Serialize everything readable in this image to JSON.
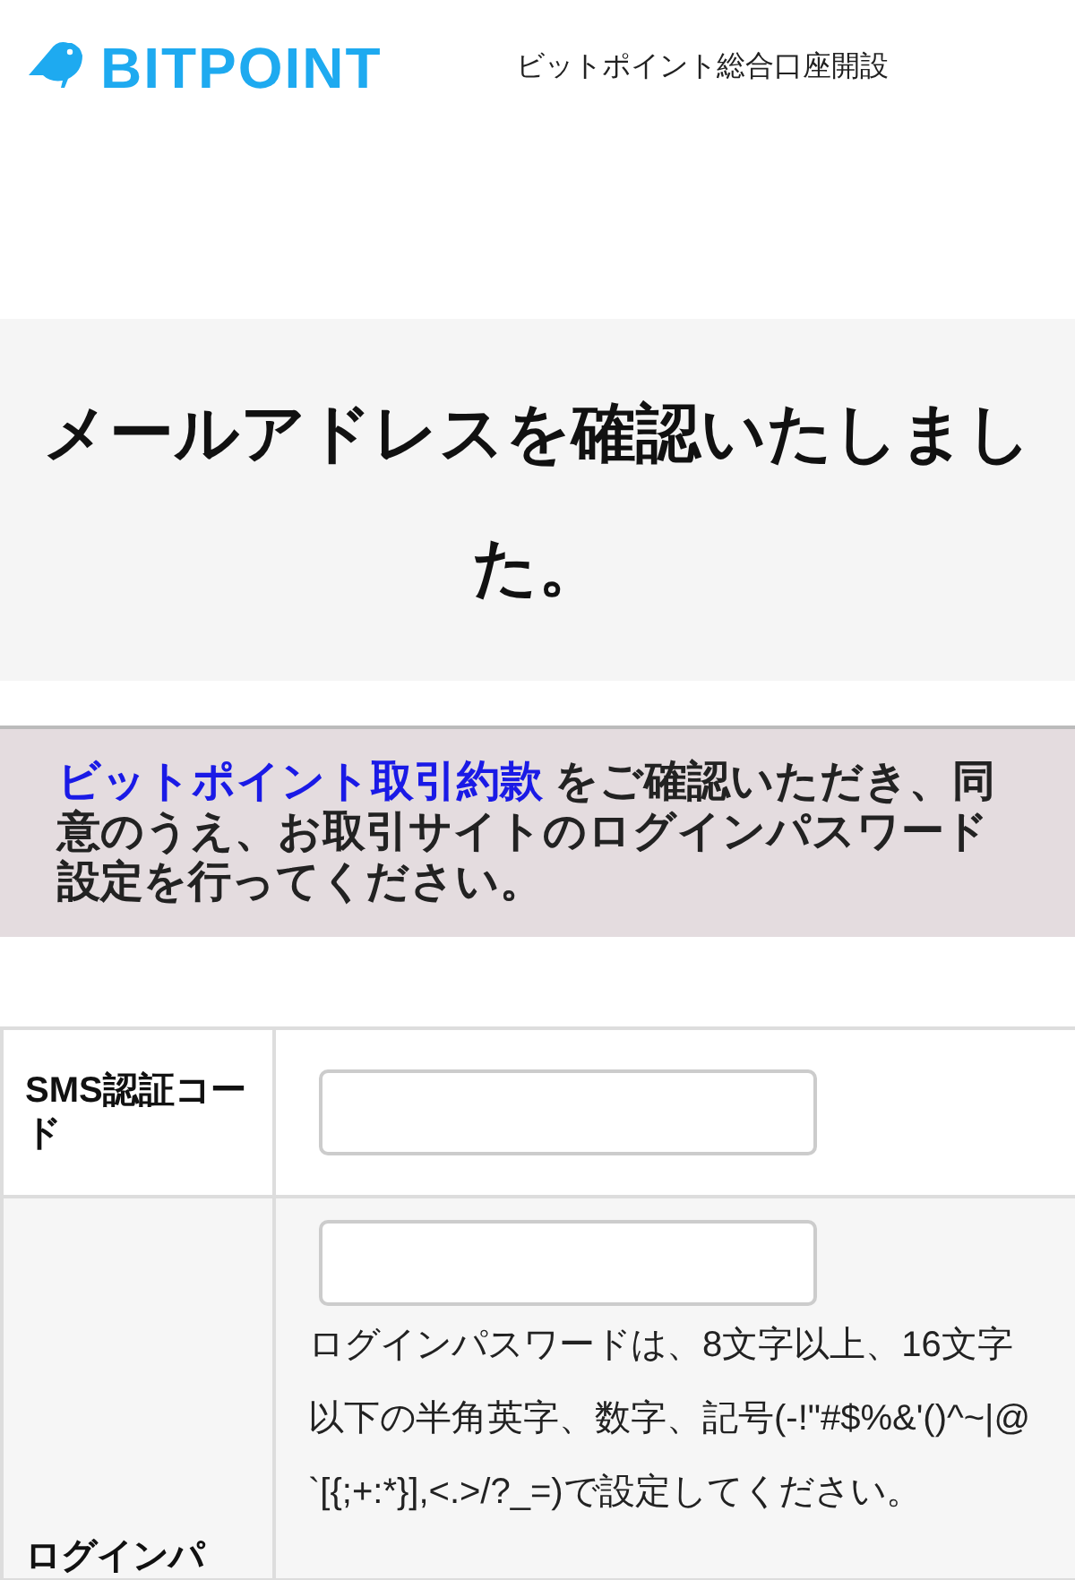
{
  "header": {
    "logo": "BITPOINT",
    "title": "ビットポイント総合口座開設"
  },
  "banner": {
    "heading": "メールアドレスを確認いたしました。"
  },
  "notice": {
    "link": "ビットポイント取引約款",
    "text": " をご確認いただき、同意のうえ、お取引サイトのログインパスワード設定を行ってください。"
  },
  "form": {
    "rows": [
      {
        "label": "SMS認証コード",
        "value": ""
      },
      {
        "label": "ログインパ",
        "value": "",
        "help": "ログインパスワードは、8文字以上、16文字以下の半角英字、数字、記号(-!\"#$%&'()^~|@`[{;+:*}],<.>/?_=)で設定してください。"
      }
    ]
  }
}
